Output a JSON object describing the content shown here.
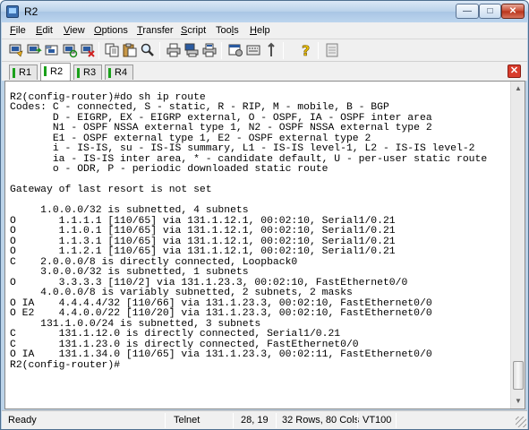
{
  "window": {
    "title": "R2"
  },
  "menu": [
    {
      "label": "File",
      "ul": "F",
      "rest": "ile"
    },
    {
      "label": "Edit",
      "ul": "E",
      "rest": "dit"
    },
    {
      "label": "View",
      "ul": "V",
      "rest": "iew"
    },
    {
      "label": "Options",
      "ul": "O",
      "rest": "ptions"
    },
    {
      "label": "Transfer",
      "ul": "T",
      "rest": "ransfer"
    },
    {
      "label": "Script",
      "ul": "S",
      "rest": "cript"
    },
    {
      "label": "Tools",
      "pre": "Too",
      "ul": "l",
      "rest": "s"
    },
    {
      "label": "Help",
      "ul": "H",
      "rest": "elp"
    }
  ],
  "toolbar": {
    "icons": [
      "connect-icon",
      "quick-connect-icon",
      "connect-in-tab-icon",
      "reconnect-icon",
      "disconnect-icon",
      "copy-icon",
      "paste-icon",
      "find-icon",
      "print-icon",
      "print-screen-icon",
      "print-selection-icon",
      "session-options-icon",
      "key-map-icon",
      "sftp-icon",
      "help-icon",
      "log-icon"
    ]
  },
  "tabs": [
    {
      "label": "R1",
      "active": false
    },
    {
      "label": "R2",
      "active": true
    },
    {
      "label": "R3",
      "active": false
    },
    {
      "label": "R4",
      "active": false
    }
  ],
  "terminal": {
    "lines": [
      "",
      "R2(config-router)#do sh ip route",
      "Codes: C - connected, S - static, R - RIP, M - mobile, B - BGP",
      "       D - EIGRP, EX - EIGRP external, O - OSPF, IA - OSPF inter area",
      "       N1 - OSPF NSSA external type 1, N2 - OSPF NSSA external type 2",
      "       E1 - OSPF external type 1, E2 - OSPF external type 2",
      "       i - IS-IS, su - IS-IS summary, L1 - IS-IS level-1, L2 - IS-IS level-2",
      "       ia - IS-IS inter area, * - candidate default, U - per-user static route",
      "       o - ODR, P - periodic downloaded static route",
      "",
      "Gateway of last resort is not set",
      "",
      "     1.0.0.0/32 is subnetted, 4 subnets",
      "O       1.1.1.1 [110/65] via 131.1.12.1, 00:02:10, Serial1/0.21",
      "O       1.1.0.1 [110/65] via 131.1.12.1, 00:02:10, Serial1/0.21",
      "O       1.1.3.1 [110/65] via 131.1.12.1, 00:02:10, Serial1/0.21",
      "O       1.1.2.1 [110/65] via 131.1.12.1, 00:02:10, Serial1/0.21",
      "C    2.0.0.0/8 is directly connected, Loopback0",
      "     3.0.0.0/32 is subnetted, 1 subnets",
      "O       3.3.3.3 [110/2] via 131.1.23.3, 00:02:10, FastEthernet0/0",
      "     4.0.0.0/8 is variably subnetted, 2 subnets, 2 masks",
      "O IA    4.4.4.4/32 [110/66] via 131.1.23.3, 00:02:10, FastEthernet0/0",
      "O E2    4.4.0.0/22 [110/20] via 131.1.23.3, 00:02:10, FastEthernet0/0",
      "     131.1.0.0/24 is subnetted, 3 subnets",
      "C       131.1.12.0 is directly connected, Serial1/0.21",
      "C       131.1.23.0 is directly connected, FastEthernet0/0",
      "O IA    131.1.34.0 [110/65] via 131.1.23.3, 00:02:11, FastEthernet0/0",
      "R2(config-router)#"
    ]
  },
  "status": {
    "state": "Ready",
    "protocol": "Telnet",
    "cursor": "28, 19",
    "size": "32 Rows, 80 Cols",
    "emulation": "VT100"
  },
  "colors": {
    "active_tab_marker": "#1aa01a",
    "close_tab": "#d83c2c",
    "close_window": "#c84a31"
  }
}
